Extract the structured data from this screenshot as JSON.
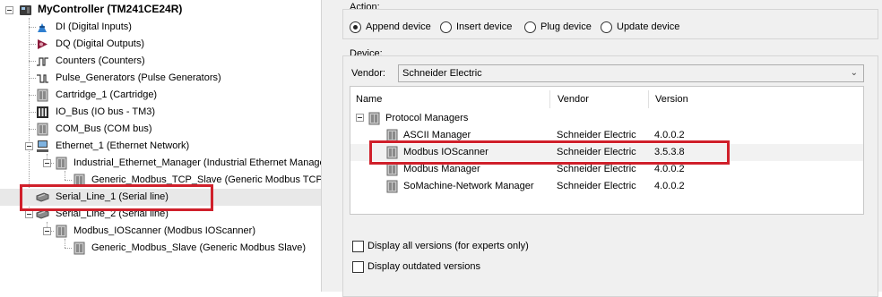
{
  "tree": {
    "root": {
      "label": "MyController (TM241CE24R)"
    },
    "items": [
      {
        "label": "DI (Digital Inputs)"
      },
      {
        "label": "DQ (Digital Outputs)"
      },
      {
        "label": "Counters (Counters)"
      },
      {
        "label": "Pulse_Generators (Pulse Generators)"
      },
      {
        "label": "Cartridge_1 (Cartridge)"
      },
      {
        "label": "IO_Bus (IO bus - TM3)"
      },
      {
        "label": "COM_Bus (COM bus)"
      },
      {
        "label": "Ethernet_1 (Ethernet Network)"
      },
      {
        "label": "Industrial_Ethernet_Manager (Industrial Ethernet Manager)"
      },
      {
        "label": "Generic_Modbus_TCP_Slave (Generic Modbus TCP Slave)"
      },
      {
        "label": "Serial_Line_1 (Serial line)"
      },
      {
        "label": "Serial_Line_2 (Serial line)"
      },
      {
        "label": "Modbus_IOScanner (Modbus IOScanner)"
      },
      {
        "label": "Generic_Modbus_Slave (Generic Modbus Slave)"
      }
    ]
  },
  "action": {
    "label": "Action:",
    "options": [
      {
        "label": "Append device",
        "checked": true
      },
      {
        "label": "Insert device",
        "checked": false
      },
      {
        "label": "Plug device",
        "checked": false
      },
      {
        "label": "Update device",
        "checked": false
      }
    ]
  },
  "device": {
    "label": "Device:",
    "vendor_label": "Vendor:",
    "vendor_value": "Schneider Electric",
    "columns": [
      "Name",
      "Vendor",
      "Version"
    ],
    "group": "Protocol Managers",
    "rows": [
      {
        "name": "ASCII Manager",
        "vendor": "Schneider Electric",
        "version": "4.0.0.2"
      },
      {
        "name": "Modbus IOScanner",
        "vendor": "Schneider Electric",
        "version": "3.5.3.8"
      },
      {
        "name": "Modbus Manager",
        "vendor": "Schneider Electric",
        "version": "4.0.0.2"
      },
      {
        "name": "SoMachine-Network Manager",
        "vendor": "Schneider Electric",
        "version": "4.0.0.2"
      }
    ]
  },
  "options": {
    "display_all_versions": "Display all versions (for experts only)",
    "display_outdated_versions": "Display outdated versions"
  },
  "colors": {
    "highlight_box": "#d0202b",
    "selection": "#e8e8e8"
  },
  "icons": {
    "controller": "controller-icon",
    "digital_inputs": "digital-inputs-icon",
    "digital_outputs": "digital-outputs-icon",
    "counters": "counter-pulse-icon",
    "pulse_generators": "pulse-generator-icon",
    "module": "module-icon",
    "io_bus": "io-bus-icon",
    "ethernet": "network-computer-icon",
    "serial": "serial-line-icon"
  }
}
